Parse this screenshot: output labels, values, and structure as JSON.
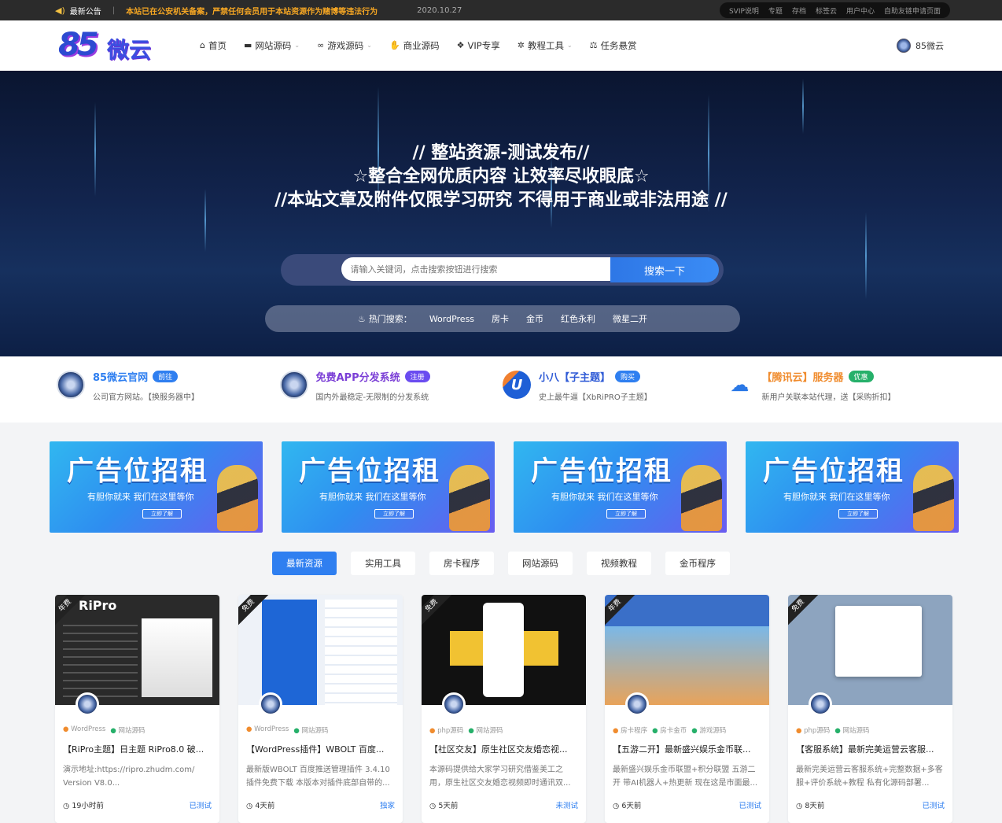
{
  "topbar": {
    "announce_label": "最新公告",
    "notice": "本站已在公安机关备案，严禁任何会员用于本站资源作为赌博等违法行为",
    "date": "2020.10.27",
    "links": [
      "SVIP说明",
      "专题",
      "存档",
      "标签云",
      "用户中心",
      "自助友链申请页面"
    ]
  },
  "header": {
    "logo_num": "85",
    "logo_cn": "微云",
    "nav": [
      {
        "label": "首页",
        "icon": "home-icon",
        "glyph": "⌂",
        "dropdown": false
      },
      {
        "label": "网站源码",
        "icon": "folder-icon",
        "glyph": "▬",
        "dropdown": true
      },
      {
        "label": "游戏源码",
        "icon": "gamepad-icon",
        "glyph": "∞",
        "dropdown": true
      },
      {
        "label": "商业源码",
        "icon": "hand-icon",
        "glyph": "✋",
        "dropdown": false
      },
      {
        "label": "VIP专享",
        "icon": "cubes-icon",
        "glyph": "❖",
        "dropdown": false
      },
      {
        "label": "教程工具",
        "icon": "gear-icon",
        "glyph": "✲",
        "dropdown": true
      },
      {
        "label": "任务悬赏",
        "icon": "scale-icon",
        "glyph": "⚖",
        "dropdown": false
      }
    ],
    "user": "85微云"
  },
  "hero": {
    "line1": "// 整站资源-测试发布//",
    "line2": "☆整合全网优质内容 让效率尽收眼底☆",
    "line3": "//本站文章及附件仅限学习研究 不得用于商业或非法用途 //",
    "search_placeholder": "请输入关键词，点击搜索按钮进行搜索",
    "search_button": "搜索一下",
    "hot_label": "热门搜索：",
    "hot": [
      "WordPress",
      "房卡",
      "金币",
      "红色永利",
      "微星二开"
    ]
  },
  "features": [
    {
      "title": "85微云官网",
      "badge": "前往",
      "badge_color": "#2f7ff0",
      "title_color": "#2f7ff0",
      "desc": "公司官方网站。【换服务器中】",
      "icon": "logo-icon"
    },
    {
      "title": "免费APP分发系统",
      "badge": "注册",
      "badge_color": "#6a4cf0",
      "title_color": "#7b3fd6",
      "desc": "国内外最稳定-无限制的分发系统",
      "icon": "logo-icon"
    },
    {
      "title": "小八【子主题】",
      "badge": "购买",
      "badge_color": "#2f7ff0",
      "title_color": "#2f5bd6",
      "desc": "史上最牛逼【XbRiPRO子主题】",
      "icon": "u-icon"
    },
    {
      "title": "【腾讯云】服务器",
      "badge": "优惠",
      "badge_color": "#26b06a",
      "title_color": "#f08c2e",
      "desc": "新用户关联本站代理，送【采购折扣】",
      "icon": "cloud-icon"
    }
  ],
  "ads": [
    {
      "title": "广告位招租",
      "sub": "有胆你就来 我们在这里等你",
      "btn": "立即了解"
    },
    {
      "title": "广告位招租",
      "sub": "有胆你就来 我们在这里等你",
      "btn": "立即了解"
    },
    {
      "title": "广告位招租",
      "sub": "有胆你就来 我们在这里等你",
      "btn": "立即了解"
    },
    {
      "title": "广告位招租",
      "sub": "有胆你就来 我们在这里等你",
      "btn": "立即了解"
    }
  ],
  "tabs": [
    "最新资源",
    "实用工具",
    "房卡程序",
    "网站源码",
    "视频教程",
    "金币程序"
  ],
  "cards": [
    {
      "ribbon": "年费",
      "tag1": "WordPress",
      "tag2": "网站源码",
      "title": "【RiPro主题】日主题 RiPro8.0 破...",
      "desc": "演示地址:https://ripro.zhudm.com/ Version V8.0...",
      "time": "19小时前",
      "status": "已测试",
      "thumb_bg": "#2a2a2a",
      "thumb_text": "RiPro"
    },
    {
      "ribbon": "免费",
      "tag1": "WordPress",
      "tag2": "网站源码",
      "title": "【WordPress插件】WBOLT 百度...",
      "desc": "最新版WBOLT 百度推送管理插件 3.4.10 插件免费下载 本版本对插件底部自带的...",
      "time": "4天前",
      "status": "独家",
      "thumb_bg": "#eef2f8",
      "thumb_text": ""
    },
    {
      "ribbon": "免费",
      "tag1": "php源码",
      "tag2": "网站源码",
      "title": "【社区交友】原生社区交友婚恋视...",
      "desc": "本源码提供给大家学习研究借鉴美工之用，原生社区交友婚恋视频即时通讯双...",
      "time": "5天前",
      "status": "未测试",
      "thumb_bg": "#111111",
      "thumb_text": ""
    },
    {
      "ribbon": "年费",
      "tag1": "房卡程序",
      "tag2": "房卡金币",
      "title": "【五游二开】最新盛兴娱乐金币联...",
      "desc": "最新盛兴娱乐金币联盟+积分联盟 五游二开 带AI机器人+热更新 现在这是市面最...",
      "time": "6天前",
      "status": "已测试",
      "thumb_bg": "#3a6fc8",
      "thumb_text": "",
      "tag3": "游戏源码"
    },
    {
      "ribbon": "免费",
      "tag1": "php源码",
      "tag2": "网站源码",
      "title": "【客服系统】最新完美运营云客服...",
      "desc": "最新完美运营云客服系统+完整数据+多客服+评价系统+教程 私有化源码部署...",
      "time": "8天前",
      "status": "已测试",
      "thumb_bg": "#8da4bf",
      "thumb_text": ""
    }
  ]
}
